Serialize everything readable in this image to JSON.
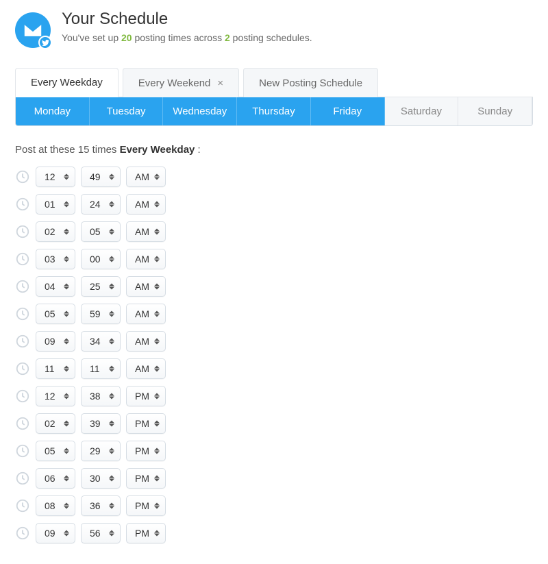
{
  "header": {
    "title": "Your Schedule",
    "subtitle_pre": "You've set up ",
    "times_count": "20",
    "subtitle_mid": " posting times across ",
    "schedules_count": "2",
    "subtitle_post": " posting schedules."
  },
  "tabs": [
    {
      "label": "Every Weekday",
      "active": true,
      "closeable": false
    },
    {
      "label": "Every Weekend",
      "active": false,
      "closeable": true
    },
    {
      "label": "New Posting Schedule",
      "active": false,
      "closeable": false
    }
  ],
  "days": [
    {
      "label": "Monday",
      "on": true
    },
    {
      "label": "Tuesday",
      "on": true
    },
    {
      "label": "Wednesday",
      "on": true
    },
    {
      "label": "Thursday",
      "on": true
    },
    {
      "label": "Friday",
      "on": true
    },
    {
      "label": "Saturday",
      "on": false
    },
    {
      "label": "Sunday",
      "on": false
    }
  ],
  "caption": {
    "pre": "Post at these 15 times ",
    "bold": "Every Weekday",
    "post": " :"
  },
  "times": [
    {
      "hour": "12",
      "min": "49",
      "ampm": "AM"
    },
    {
      "hour": "01",
      "min": "24",
      "ampm": "AM"
    },
    {
      "hour": "02",
      "min": "05",
      "ampm": "AM"
    },
    {
      "hour": "03",
      "min": "00",
      "ampm": "AM"
    },
    {
      "hour": "04",
      "min": "25",
      "ampm": "AM"
    },
    {
      "hour": "05",
      "min": "59",
      "ampm": "AM"
    },
    {
      "hour": "09",
      "min": "34",
      "ampm": "AM"
    },
    {
      "hour": "11",
      "min": "11",
      "ampm": "AM"
    },
    {
      "hour": "12",
      "min": "38",
      "ampm": "PM"
    },
    {
      "hour": "02",
      "min": "39",
      "ampm": "PM"
    },
    {
      "hour": "05",
      "min": "29",
      "ampm": "PM"
    },
    {
      "hour": "06",
      "min": "30",
      "ampm": "PM"
    },
    {
      "hour": "08",
      "min": "36",
      "ampm": "PM"
    },
    {
      "hour": "09",
      "min": "56",
      "ampm": "PM"
    }
  ],
  "icons": {
    "close_glyph": "×"
  }
}
